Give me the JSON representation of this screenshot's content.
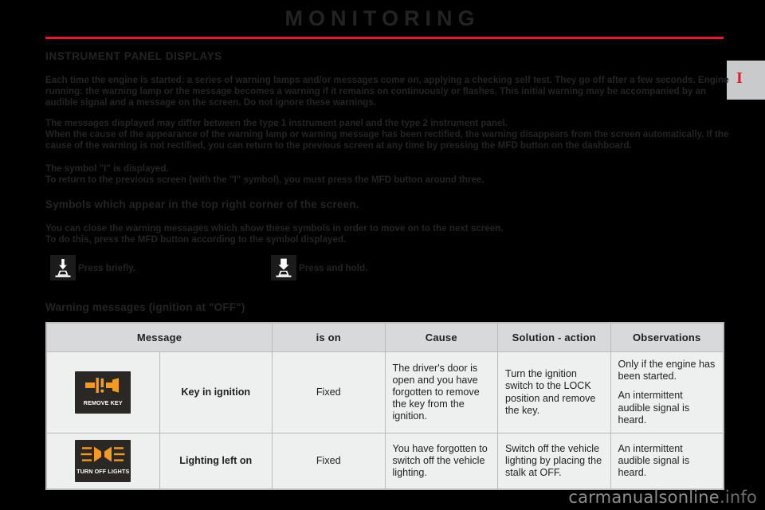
{
  "page": {
    "title": "MONITORING",
    "chapter_tab_marker": "I",
    "accent_color": "#e8192c",
    "watermark": "carmanualsonline",
    "watermark_suffix": ".info"
  },
  "sections": {
    "instrument_panel": {
      "heading": "INSTRUMENT PANEL DISPLAYS",
      "paragraphs": [
        "Each time the engine is started: a series of warning lamps and/or messages come on, applying a checking self test. They go off after a few seconds. Engine running: the warning lamp or the message becomes a warning if it remains on continuously or flashes. This initial warning may be accompanied by an audible signal and a message on the screen. Do not ignore these warnings.",
        "The messages displayed may differ between the type 1 instrument panel and the type 2 instrument panel.",
        "When the cause of the appearance of the warning lamp or warning message has been rectified, the warning disappears from the screen automatically. If the cause of the warning is not rectified, you can return to the previous screen at any time by pressing the MFD button on the dashboard.",
        "The symbol \"I\" is displayed.",
        "To return to the previous screen (with the \"I\" symbol), you must press the MFD button around three."
      ]
    },
    "symbols": {
      "heading": "Symbols which appear in the top right corner of the screen.",
      "paragraphs": [
        "You can close the warning messages which show these symbols in order to move on to the next screen.",
        "To do this, press the MFD button according to the symbol displayed."
      ],
      "items": [
        {
          "icon": "press-briefly-icon",
          "label": "Press briefly."
        },
        {
          "icon": "press-and-hold-icon",
          "label": "Press and hold."
        }
      ]
    },
    "warning_messages": {
      "heading": "Warning messages (ignition at \"OFF\")",
      "columns": [
        "Message",
        "is on",
        "Cause",
        "Solution - action",
        "Observations"
      ],
      "rows": [
        {
          "lamp_caption": "REMOVE KEY",
          "lamp_icon": "remove-key-lamp-icon",
          "message": "Key in ignition",
          "is_on": "Fixed",
          "cause": "The driver's door is open and you have forgotten to remove the key from the ignition.",
          "solution": "Turn the ignition switch to the LOCK position and remove the key.",
          "observations": [
            "Only if the engine has been started.",
            "An intermittent audible signal is heard."
          ]
        },
        {
          "lamp_caption": "TURN OFF LIGHTS",
          "lamp_icon": "turn-off-lights-lamp-icon",
          "message": "Lighting left on",
          "is_on": "Fixed",
          "cause": "You have forgotten to switch off the vehicle lighting.",
          "solution": "Switch off the vehicle lighting by placing the stalk at OFF.",
          "observations": [
            "An intermittent audible signal is heard."
          ]
        }
      ]
    }
  }
}
